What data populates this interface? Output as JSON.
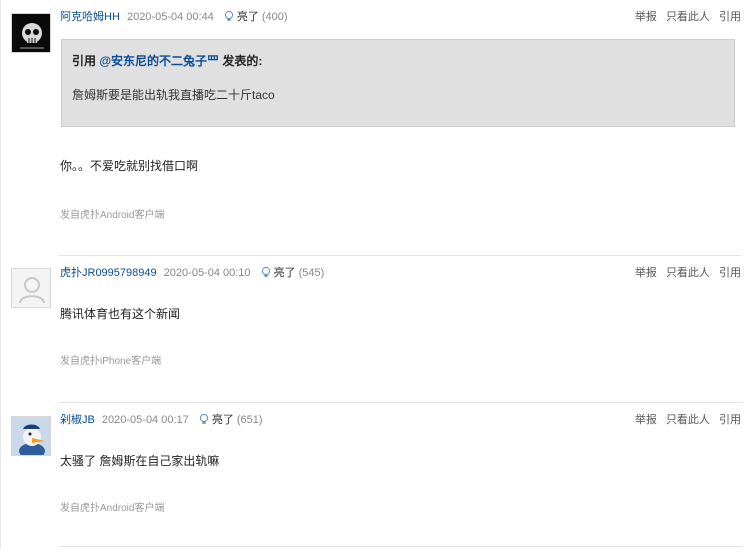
{
  "posts": [
    {
      "author": "阿克哈姆HH",
      "time": "2020-05-04 00:44",
      "light_label": "亮了",
      "light_count": "(400)",
      "quote": {
        "prefix": "引用 ",
        "user": "@安东尼的不二兔子罒",
        "suffix": " 发表的:",
        "text": "詹姆斯要是能出轨我直播吃二十斤taco"
      },
      "content": "你。。不爱吃就别找借口啊",
      "source": "发自虎扑Android客户端"
    },
    {
      "author": "虎扑JR0995798949",
      "time": "2020-05-04 00:10",
      "light_label": "亮了",
      "light_count": "(545)",
      "content": "腾讯体育也有这个新闻",
      "source": "发自虎扑iPhone客户端"
    },
    {
      "author": "剁椒JB",
      "time": "2020-05-04 00:17",
      "light_label": "亮了",
      "light_count": "(651)",
      "content": "太骚了 詹姆斯在自己家出轨嘛",
      "source": "发自虎扑Android客户端"
    }
  ],
  "actions": {
    "report": "举报",
    "only_this": "只看此人",
    "quote": "引用"
  },
  "colors": {
    "author_link": "#0b4c97",
    "quote_bg": "#e0e0e0",
    "muted": "#999999"
  }
}
